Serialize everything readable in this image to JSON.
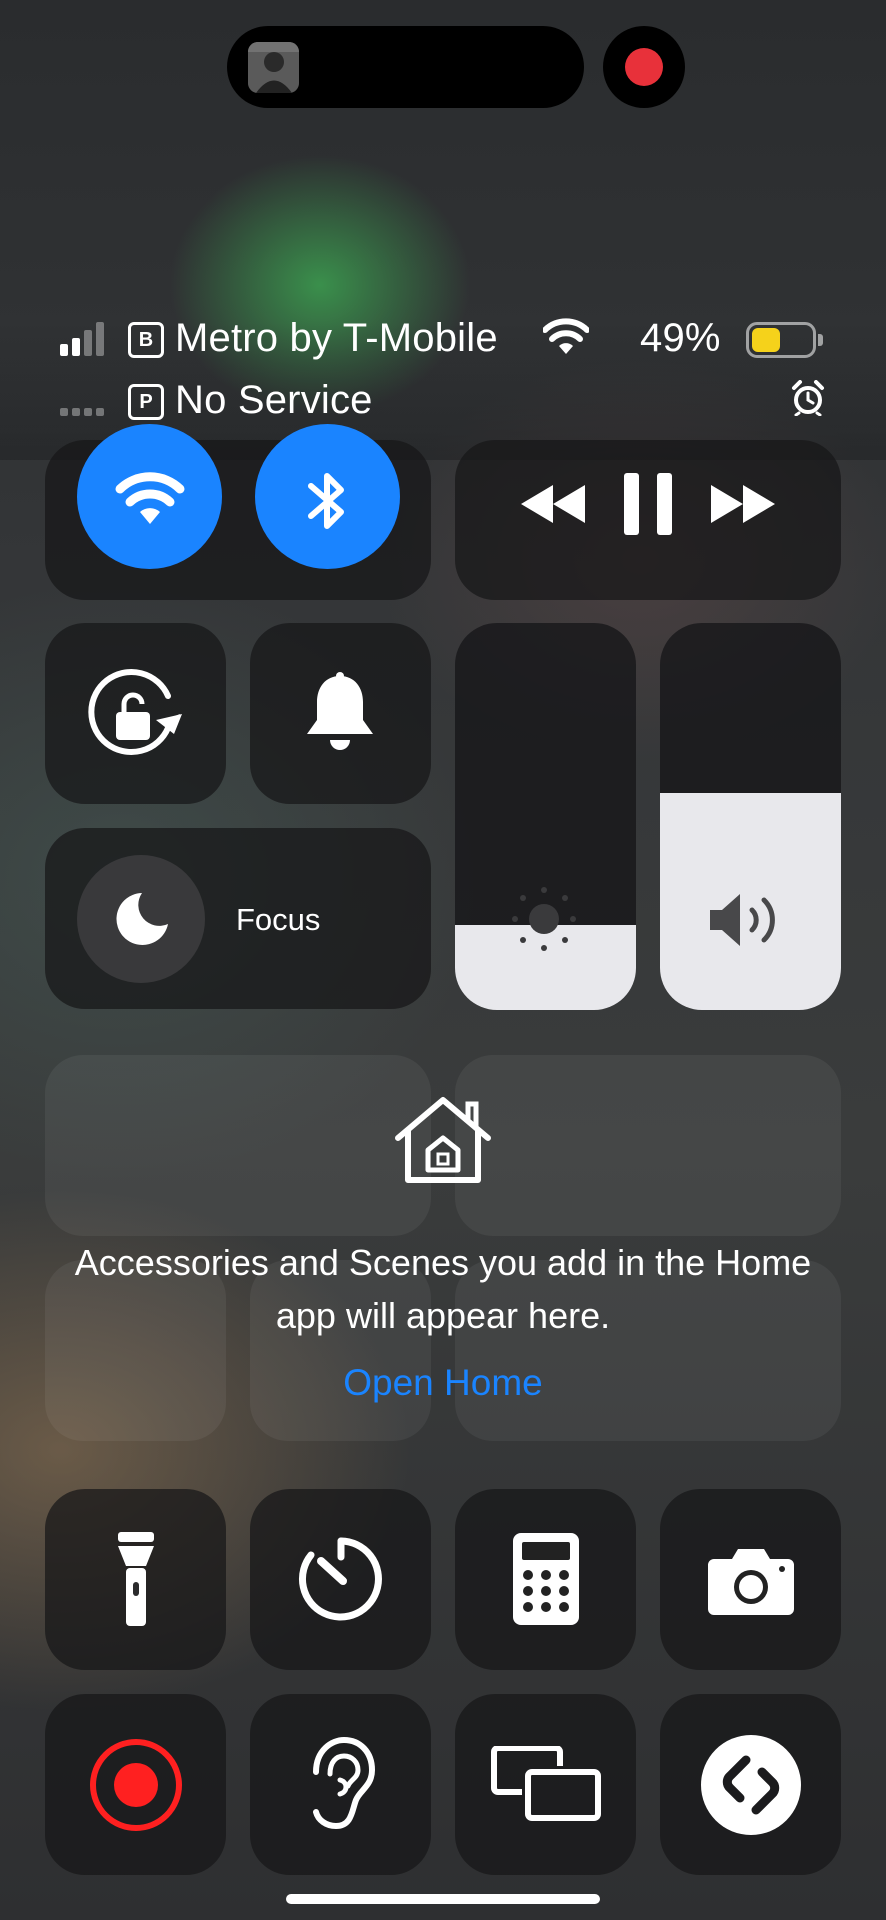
{
  "status_bar": {
    "carrier_primary": "Metro by T-Mobile",
    "sim_primary": "B",
    "carrier_secondary": "No Service",
    "sim_secondary": "P",
    "battery_percent": "49%",
    "battery_level": 0.49,
    "battery_color": "#f5d21b"
  },
  "recording_indicator_color": "#e8313a",
  "accent_color": "#1a84ff",
  "connectivity": {
    "wifi_on": true,
    "bluetooth_on": true
  },
  "media": {
    "controls": [
      "previous",
      "pause",
      "next"
    ]
  },
  "sliders": {
    "brightness_level": 0.22,
    "volume_level": 0.56
  },
  "focus": {
    "label": "Focus"
  },
  "home": {
    "message": "Accessories and Scenes you add in the Home app will appear here.",
    "link_label": "Open Home"
  },
  "shortcuts": [
    "flashlight-icon",
    "timer-icon",
    "calculator-icon",
    "camera-icon",
    "screen-record-icon",
    "hearing-icon",
    "screen-mirroring-icon",
    "shazam-icon"
  ]
}
